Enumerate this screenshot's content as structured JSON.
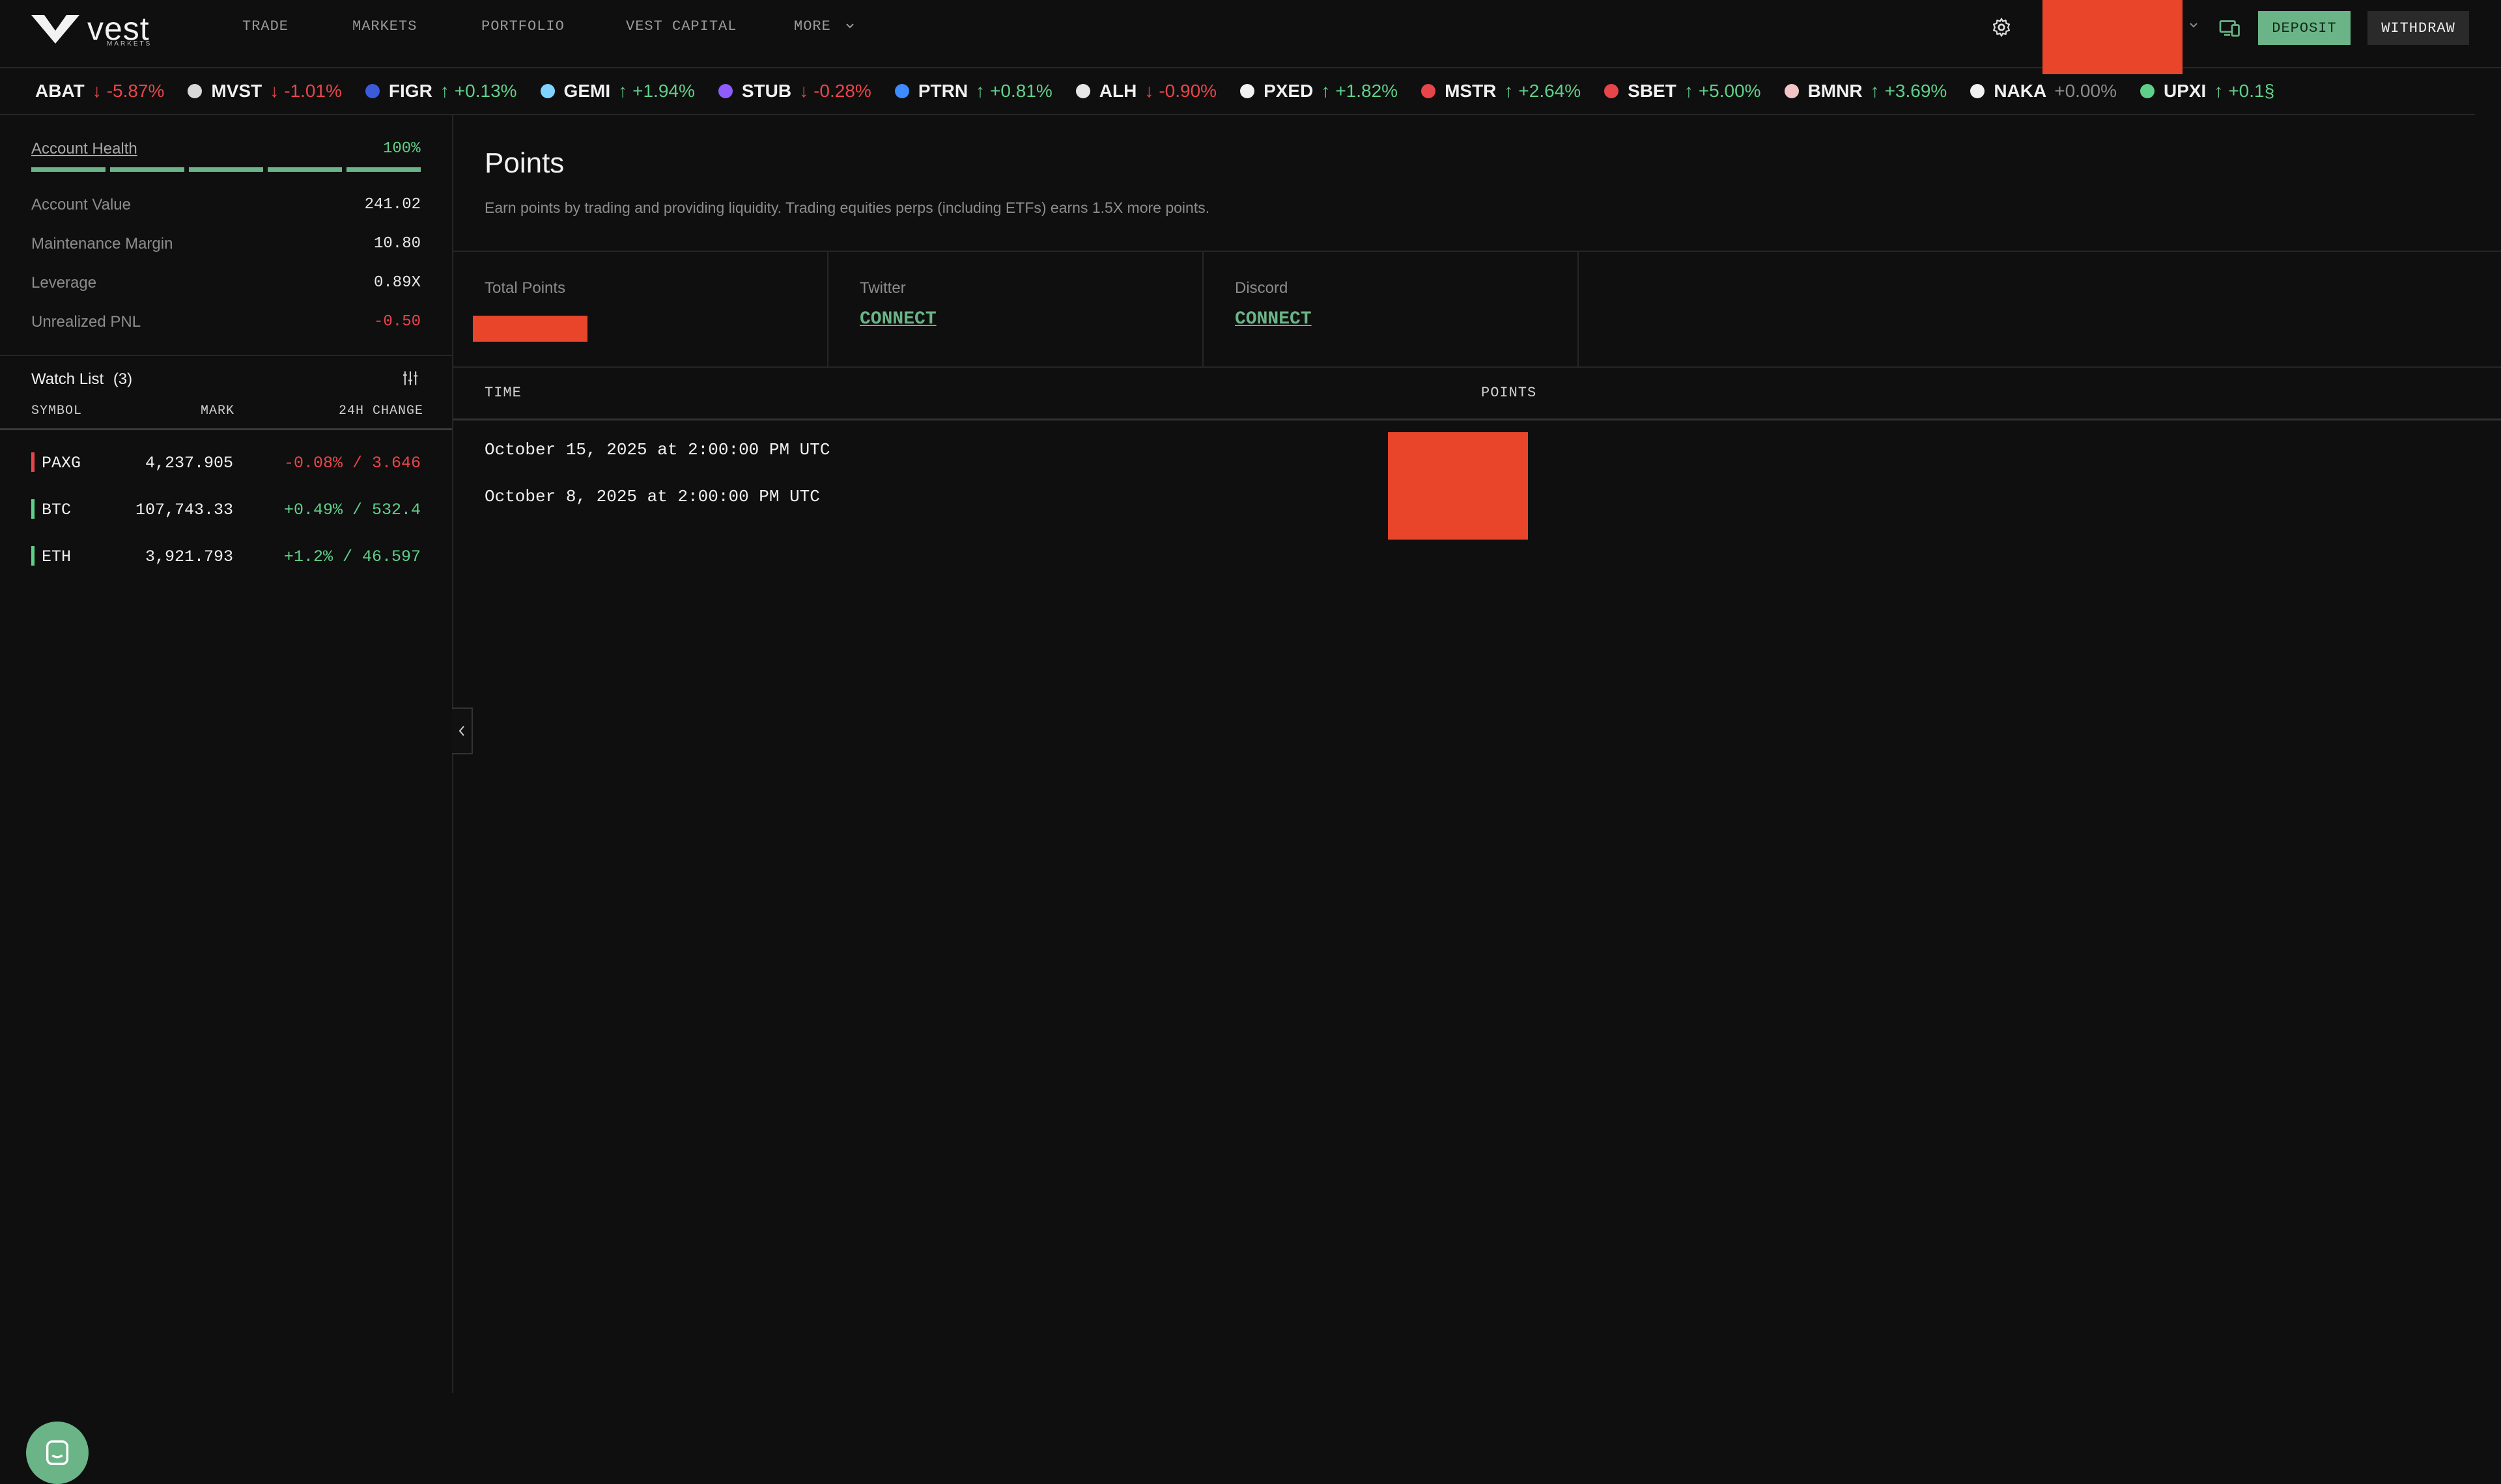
{
  "brand": {
    "name": "vest",
    "tagline": "MARKETS"
  },
  "nav": {
    "items": [
      "TRADE",
      "MARKETS",
      "PORTFOLIO",
      "VEST CAPITAL",
      "MORE"
    ]
  },
  "header": {
    "deposit_label": "DEPOSIT",
    "withdraw_label": "WITHDRAW"
  },
  "ticker": [
    {
      "symbol": "ABAT",
      "direction": "down",
      "change": "-5.87%",
      "icon_color": ""
    },
    {
      "symbol": "MVST",
      "direction": "down",
      "change": "-1.01%",
      "icon_color": "#d9d9d9"
    },
    {
      "symbol": "FIGR",
      "direction": "up",
      "change": "+0.13%",
      "icon_color": "#3b5bdb"
    },
    {
      "symbol": "GEMI",
      "direction": "up",
      "change": "+1.94%",
      "icon_color": "#7fd3ff"
    },
    {
      "symbol": "STUB",
      "direction": "down",
      "change": "-0.28%",
      "icon_color": "#8e5cff"
    },
    {
      "symbol": "PTRN",
      "direction": "up",
      "change": "+0.81%",
      "icon_color": "#3d8bff"
    },
    {
      "symbol": "ALH",
      "direction": "down",
      "change": "-0.90%",
      "icon_color": "#e6e6e6"
    },
    {
      "symbol": "PXED",
      "direction": "up",
      "change": "+1.82%",
      "icon_color": "#f2f2f2"
    },
    {
      "symbol": "MSTR",
      "direction": "up",
      "change": "+2.64%",
      "icon_color": "#e8454b"
    },
    {
      "symbol": "SBET",
      "direction": "up",
      "change": "+5.00%",
      "icon_color": "#e8454b"
    },
    {
      "symbol": "BMNR",
      "direction": "up",
      "change": "+3.69%",
      "icon_color": "#f2c6c6"
    },
    {
      "symbol": "NAKA",
      "direction": "flat",
      "change": "+0.00%",
      "icon_color": "#f2f2f2"
    },
    {
      "symbol": "UPXI",
      "direction": "up",
      "change": "+0.1§",
      "icon_color": "#5fd08a"
    }
  ],
  "account": {
    "health_label": "Account Health",
    "health_pct": "100%",
    "health_fraction": 1.0,
    "stats": [
      {
        "label": "Account Value",
        "value": "241.02",
        "tone": "neutral"
      },
      {
        "label": "Maintenance Margin",
        "value": "10.80",
        "tone": "neutral"
      },
      {
        "label": "Leverage",
        "value": "0.89X",
        "tone": "neutral"
      },
      {
        "label": "Unrealized PNL",
        "value": "-0.50",
        "tone": "negative"
      }
    ]
  },
  "watchlist": {
    "title": "Watch List",
    "count": "(3)",
    "headers": {
      "symbol": "SYMBOL",
      "mark": "MARK",
      "change": "24H CHANGE"
    },
    "rows": [
      {
        "symbol": "PAXG",
        "mark": "4,237.905",
        "change": "-0.08% / 3.646",
        "tone": "negative"
      },
      {
        "symbol": "BTC",
        "mark": "107,743.33",
        "change": "+0.49% / 532.4",
        "tone": "positive"
      },
      {
        "symbol": "ETH",
        "mark": "3,921.793",
        "change": "+1.2% / 46.597",
        "tone": "positive"
      }
    ]
  },
  "points": {
    "title": "Points",
    "description": "Earn points by trading and providing liquidity. Trading equities perps (including ETFs) earns 1.5X more points.",
    "cards": {
      "total_label": "Total Points",
      "twitter_label": "Twitter",
      "twitter_action": "CONNECT",
      "discord_label": "Discord",
      "discord_action": "CONNECT"
    },
    "table": {
      "headers": {
        "time": "TIME",
        "points": "POINTS"
      },
      "rows": [
        {
          "time": "October 15, 2025 at 2:00:00 PM UTC"
        },
        {
          "time": "October 8, 2025 at 2:00:00 PM UTC"
        }
      ]
    }
  },
  "colors": {
    "accent_green": "#6ab487",
    "positive": "#5fd08a",
    "negative": "#e8454b",
    "redaction": "#e8452a",
    "background": "#0f0f0f"
  }
}
